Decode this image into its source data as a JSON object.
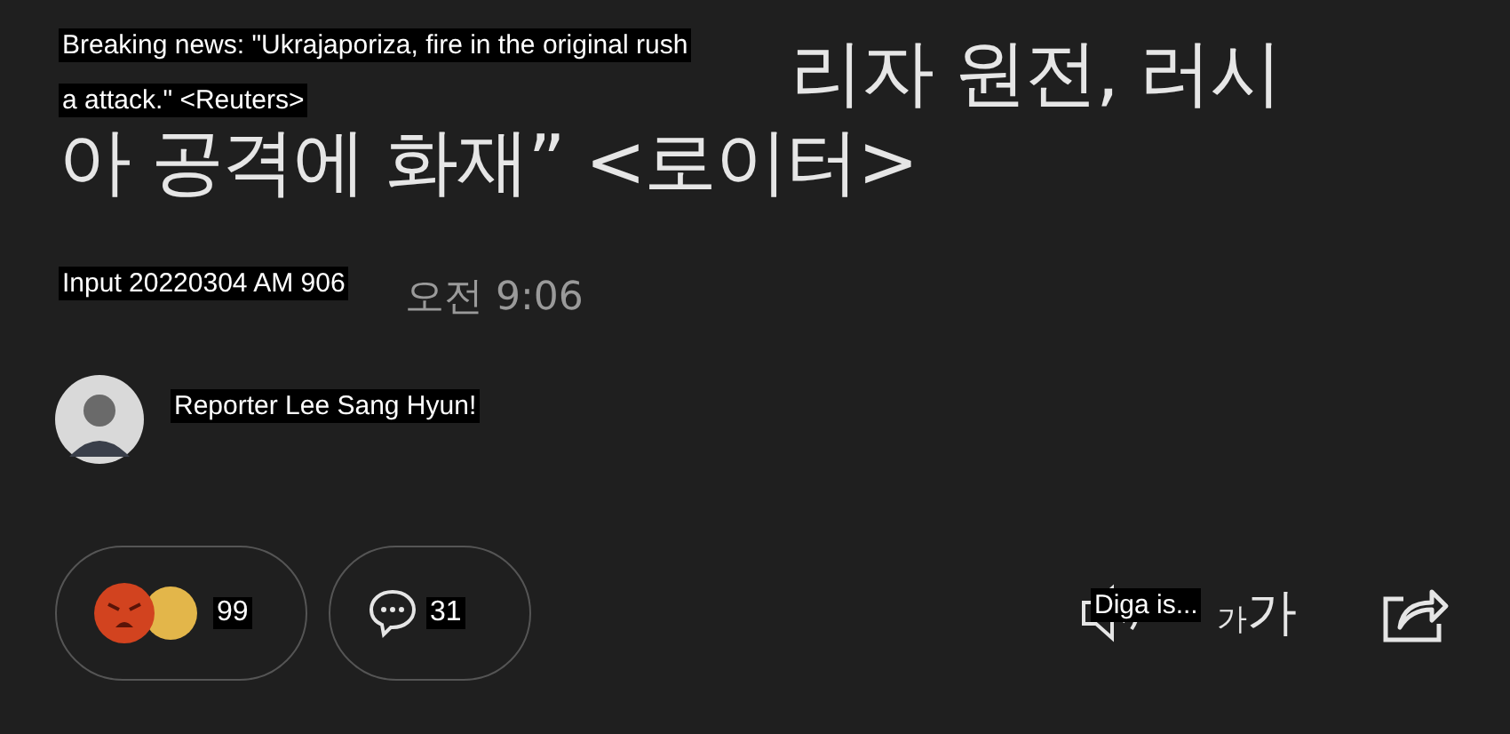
{
  "headline": {
    "lines": [
      "리자 원전, 러시",
      "아 공격에 화재” <로이터>"
    ],
    "translation_lines": [
      "Breaking news: \"Ukrajaporiza, fire in the original rush",
      "a attack.\" <Reuters>"
    ]
  },
  "timestamp": {
    "time": "오전 9:06",
    "translation": "Input 20220304 AM 906"
  },
  "reporter": {
    "translation": "Reporter Lee Sang Hyun!"
  },
  "toolbar": {
    "reactions_count": "99",
    "comments_count": "31",
    "text_size": {
      "small": "가",
      "large": "가"
    },
    "translation": "Diga is..."
  }
}
